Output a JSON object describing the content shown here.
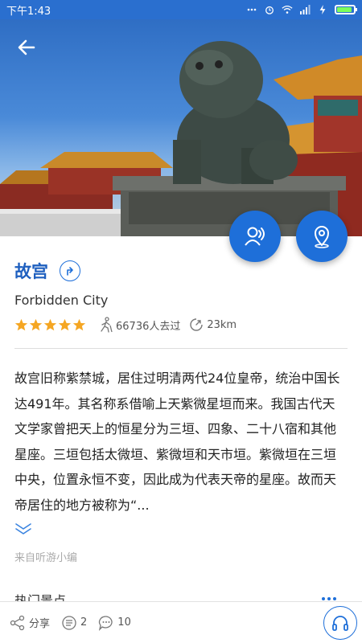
{
  "status_bar": {
    "time": "下午1:43"
  },
  "colors": {
    "accent": "#1e6fd9",
    "title": "#1e5fbf",
    "star": "#f5a623",
    "status_bar": "#2a6fcf"
  },
  "attraction": {
    "name": "故宫",
    "english_name": "Forbidden City",
    "rating": 5,
    "visitors": "66736人去过",
    "distance": "23km"
  },
  "description": "故宫旧称紫禁城，居住过明清两代24位皇帝，统治中国长达491年。其名称系借喻上天紫微星垣而来。我国古代天文学家曾把天上的恒星分为三垣、四象、二十八宿和其他星座。三垣包括太微垣、紫微垣和天市垣。紫微垣在三垣中央，位置永恒不变，因此成为代表天帝的星座。故而天帝居住的地方被称为“...",
  "source": "来自听游小编",
  "section": {
    "title": "热门景点"
  },
  "bottom_bar": {
    "share_label": "分享",
    "list_count": "2",
    "comment_count": "10"
  },
  "icons": {
    "back": "back-arrow-icon",
    "guide": "guide-person-icon",
    "map": "map-pin-icon",
    "navigate": "navigate-icon",
    "visitors": "walker-icon",
    "distance": "distance-icon",
    "expand": "chevron-double-down-icon",
    "more": "more-dots-icon",
    "share": "share-icon",
    "list": "list-icon",
    "comment": "comment-icon",
    "audio": "headphones-icon"
  }
}
